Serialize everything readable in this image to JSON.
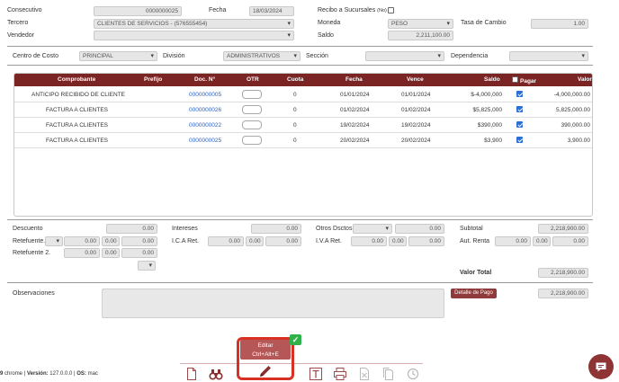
{
  "header": {
    "consecutivo_label": "Consecutivo",
    "consecutivo_value": "0000000025",
    "fecha_label": "Fecha",
    "fecha_value": "18/03/2024",
    "recibo_label": "Recibo a Sucursales",
    "recibo_suffix": "(No)",
    "tercero_label": "Tercero",
    "tercero_value": "CLIENTES DE SERVICIOS - (576555454)",
    "moneda_label": "Moneda",
    "moneda_value": "PESO",
    "tasa_label": "Tasa de Cambio",
    "tasa_value": "1.00",
    "vendedor_label": "Vendedor",
    "vendedor_value": "",
    "saldo_label": "Saldo",
    "saldo_value": "2,211,100.00"
  },
  "filters": {
    "centro_label": "Centro de Costo",
    "centro_value": "PRINCIPAL",
    "division_label": "División",
    "division_value": "ADMINISTRATIVOS",
    "seccion_label": "Sección",
    "seccion_value": "",
    "dependencia_label": "Dependencia",
    "dependencia_value": ""
  },
  "table": {
    "columns": {
      "comprobante": "Comprobante",
      "prefijo": "Prefijo",
      "doc": "Doc. N°",
      "otr": "OTR",
      "cuota": "Cuota",
      "fecha": "Fecha",
      "vence": "Vence",
      "saldo": "Saldo",
      "pagar": "Pagar",
      "valor": "Valor"
    },
    "rows": [
      {
        "comprobante": "ANTICIPO RECIBIDO DE CLIENTE",
        "doc": "0000000005",
        "cuota": "0",
        "fecha": "01/01/2024",
        "vence": "01/01/2024",
        "saldo": "$-4,000,000",
        "valor": "-4,000,000.00"
      },
      {
        "comprobante": "FACTURA A CLIENTES",
        "doc": "0000000026",
        "cuota": "0",
        "fecha": "01/02/2024",
        "vence": "01/02/2024",
        "saldo": "$5,825,000",
        "valor": "5,825,000.00"
      },
      {
        "comprobante": "FACTURA A CLIENTES",
        "doc": "0000000022",
        "cuota": "0",
        "fecha": "19/02/2024",
        "vence": "19/02/2024",
        "saldo": "$390,000",
        "valor": "390,000.00"
      },
      {
        "comprobante": "FACTURA A CLIENTES",
        "doc": "0000000025",
        "cuota": "0",
        "fecha": "20/02/2024",
        "vence": "20/02/2024",
        "saldo": "$3,900",
        "valor": "3,900.00"
      }
    ]
  },
  "totals": {
    "descuento_label": "Descuento",
    "descuento_value": "0.00",
    "retefuente_label": "Retefuente.",
    "retefuente_a": "0.00",
    "retefuente_b": "0.00",
    "retefuente_c": "0.00",
    "retefuente2_label": "Retefuente 2.",
    "retefuente2_a": "0.00",
    "retefuente2_b": "0.00",
    "retefuente2_c": "0.00",
    "intereses_label": "Intereses",
    "intereses_value": "0.00",
    "ica_label": "I.C.A Ret.",
    "ica_a": "0.00",
    "ica_b": "0.00",
    "ica_c": "0.00",
    "otros_label": "Otros Dsctos.",
    "otros_value": "0.00",
    "iva_label": "I.V.A Ret.",
    "iva_a": "0.00",
    "iva_b": "0.00",
    "iva_c": "0.00",
    "subtotal_label": "Subtotal",
    "subtotal_value": "2,218,900.00",
    "aut_label": "Aut. Renta",
    "aut_a": "0.00",
    "aut_b": "0.00",
    "aut_c": "0.00",
    "valor_total_label": "Valor Total",
    "valor_total_value": "2,218,900.00"
  },
  "observaciones": {
    "label": "Observaciones",
    "detalle_button": "Detalle de Pago",
    "detalle_value": "2,218,900.00"
  },
  "toolbar": {
    "tooltip_line1": "Editar",
    "tooltip_line2": "Ctrl+Alt+E"
  },
  "footer": {
    "prefix": "9",
    "browser": "chrome",
    "version_label": "Versión:",
    "version_value": "127.0.0.0",
    "os_label": "OS:",
    "os_value": "mac"
  },
  "colors": {
    "header_bg": "#7a2424",
    "accent": "#8f3434",
    "link": "#2a62c8",
    "check": "#2a6fd8",
    "highlight": "#d93025"
  }
}
